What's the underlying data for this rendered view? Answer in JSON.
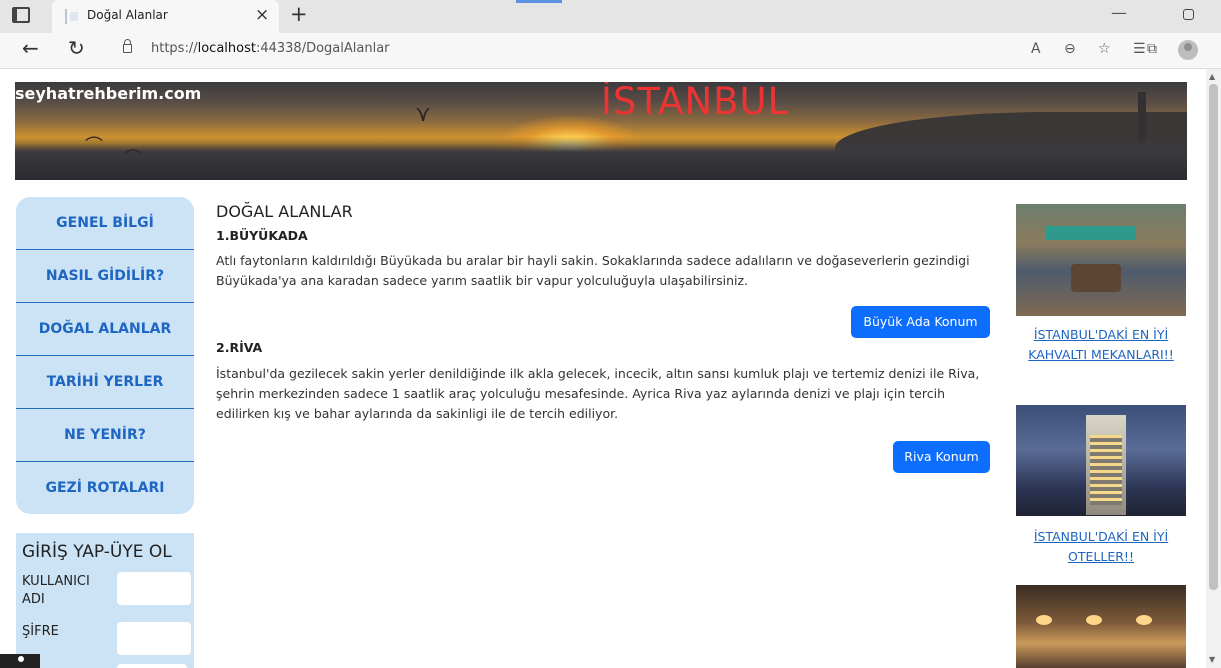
{
  "browser": {
    "tab_title": "Doğal Alanlar",
    "tab_close": "×",
    "new_tab": "+",
    "url_prefix": "https://",
    "url_host": "localhost",
    "url_rest": ":44338/DogalAlanlar"
  },
  "header": {
    "site_name": "seyhatrehberim.com",
    "city": "İSTANBUL"
  },
  "sidebar": {
    "items": [
      {
        "label": "GENEL BİLGİ"
      },
      {
        "label": "NASIL GİDİLİR?"
      },
      {
        "label": "DOĞAL ALANLAR"
      },
      {
        "label": "TARİHİ YERLER"
      },
      {
        "label": "NE YENİR?"
      },
      {
        "label": "GEZİ ROTALARI"
      }
    ]
  },
  "login": {
    "title": "GİRİŞ YAP-ÜYE OL",
    "username_label": "KULLANICI ADI",
    "password_label": "ŞİFRE"
  },
  "main": {
    "title": "DOĞAL ALANLAR",
    "sections": [
      {
        "heading": "1.BÜYÜKADA",
        "text": "Atlı faytonların kaldırıldığı Büyükada bu aralar bir hayli sakin. Sokaklarında sadece adalıların ve doğaseverlerin gezindigi Büyükada'ya ana karadan sadece yarım saatlik bir vapur yolculuğuyla ulaşabilirsiniz.",
        "button": "Büyük Ada Konum"
      },
      {
        "heading": "2.RİVA",
        "text": "İstanbul'da gezilecek sakin yerler denildiğinde ilk akla gelecek, incecik, altın sansı kumluk plajı ve tertemiz denizi ile Riva, şehrin merkezinden sadece 1 saatlik araç yolculuğu mesafesinde. Ayrica Riva yaz aylarında denizi ve plajı için tercih edilirken kış ve bahar aylarında da sakinligi ile de tercih ediliyor.",
        "button": "Riva Konum"
      }
    ]
  },
  "right": {
    "links": [
      {
        "label": "İSTANBUL'DAKİ EN İYİ KAHVALTI MEKANLARI!!"
      },
      {
        "label": "İSTANBUL'DAKİ EN İYİ OTELLER!!"
      }
    ]
  }
}
